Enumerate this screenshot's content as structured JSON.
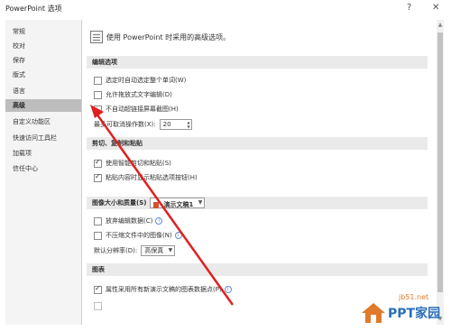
{
  "window": {
    "title": "PowerPoint 选项",
    "help": "?",
    "close": "✕"
  },
  "sidebar": {
    "items": [
      {
        "label": "常规"
      },
      {
        "label": "校对"
      },
      {
        "label": "保存"
      },
      {
        "label": "版式"
      },
      {
        "label": "语言"
      },
      {
        "label": "高级",
        "active": true
      },
      {
        "label": "自定义功能区"
      },
      {
        "label": "快速访问工具栏"
      },
      {
        "label": "加载项"
      },
      {
        "label": "信任中心"
      }
    ]
  },
  "main": {
    "intro": "使用 PowerPoint 时采用的高级选项。",
    "sections": {
      "editing": {
        "header": "编辑选项",
        "opt1": "选定时自动选定整个单词(W)",
        "opt2": "允许拖放式文字编辑(D)",
        "opt3": "不自动超链接屏幕截图(H)",
        "undo_label": "最多可取消操作数(X):",
        "undo_value": "20"
      },
      "clipboard": {
        "header": "剪切、复制和粘贴",
        "opt1": "使用智能剪切和粘贴(S)",
        "opt2": "粘贴内容时显示粘贴选项按钮(H)"
      },
      "image": {
        "header": "图像大小和质量(S)",
        "doc_select": "演示文稿1",
        "opt1": "放弃编辑数据(C)",
        "opt2": "不压缩文件中的图像(N)",
        "resolution_label": "默认分辨率(D):",
        "resolution_value": "高保真"
      },
      "chart": {
        "header": "图表",
        "opt1": "属性采用所有新演示文稿的图表数据点(P)"
      }
    }
  },
  "watermark": {
    "url": "jb51.net",
    "brand": "PPT家园"
  },
  "colors": {
    "active_sidebar": "#bdbdbd",
    "section_header": "#eaeaea",
    "annotation_arrow": "#e02020",
    "brand_orange": "#e07a2a",
    "brand_blue": "#2a6fb8"
  }
}
